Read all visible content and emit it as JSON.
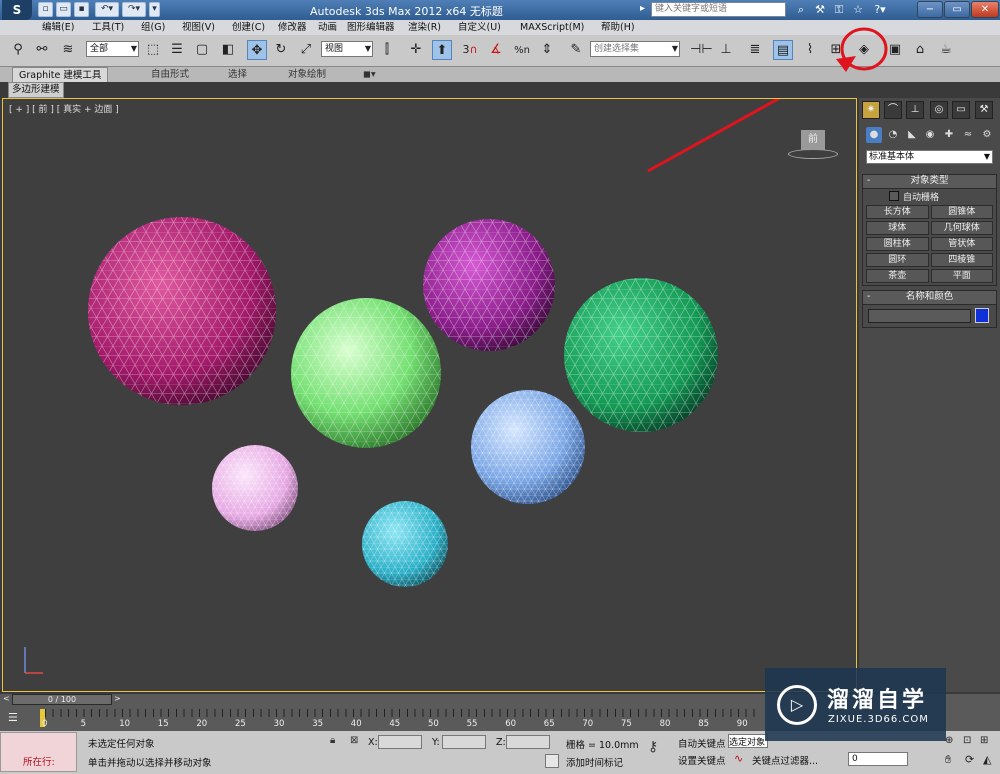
{
  "titlebar": {
    "title": "Autodesk 3ds Max  2012 x64      无标题",
    "search_placeholder": "键入关键字或短语",
    "accent": "#3b6aa3"
  },
  "menu": [
    "编辑(E)",
    "工具(T)",
    "组(G)",
    "视图(V)",
    "创建(C)",
    "修改器",
    "动画",
    "图形编辑器",
    "渲染(R)",
    "自定义(U)",
    "MAXScript(M)",
    "帮助(H)"
  ],
  "toolbar": {
    "selection_filter": "全部",
    "ref_coord": "视图",
    "named_selection": "创建选择集",
    "snap_number": "3",
    "percent": "%n"
  },
  "ribbon": {
    "tabs": [
      "Graphite 建模工具",
      "自由形式",
      "选择",
      "对象绘制"
    ],
    "subtab": "多边形建模"
  },
  "viewport": {
    "label": "[ + ] [ 前 ] [ 真实 + 边面 ]",
    "viewcube": "前"
  },
  "command_panel": {
    "category": "标准基本体",
    "object_type_title": "对象类型",
    "autogrid": "自动栅格",
    "buttons": [
      "长方体",
      "圆锥体",
      "球体",
      "几何球体",
      "圆柱体",
      "管状体",
      "圆环",
      "四棱锥",
      "茶壶",
      "平面"
    ],
    "name_color_title": "名称和颜色",
    "object_color": "#1030d8"
  },
  "timeline": {
    "frame": "0 / 100",
    "ticks": [
      "0",
      "5",
      "10",
      "15",
      "20",
      "25",
      "30",
      "35",
      "40",
      "45",
      "50",
      "55",
      "60",
      "65",
      "70",
      "75",
      "80",
      "85",
      "90"
    ]
  },
  "status": {
    "mini_listener": "所在行:",
    "selection": "未选定任何对象",
    "prompt": "单击并拖动以选择并移动对象",
    "x_label": "X:",
    "y_label": "Y:",
    "z_label": "Z:",
    "grid": "栅格 = 10.0mm",
    "add_time_tag": "添加时间标记",
    "auto_key": "自动关键点",
    "set_key": "设置关键点",
    "selected_object": "选定对象",
    "key_filters": "关键点过滤器...",
    "frame_value": "0"
  },
  "watermark": {
    "brand": "溜溜自学",
    "url": "ZIXUE.3D66.COM"
  },
  "annotation_color": "#e0141e"
}
